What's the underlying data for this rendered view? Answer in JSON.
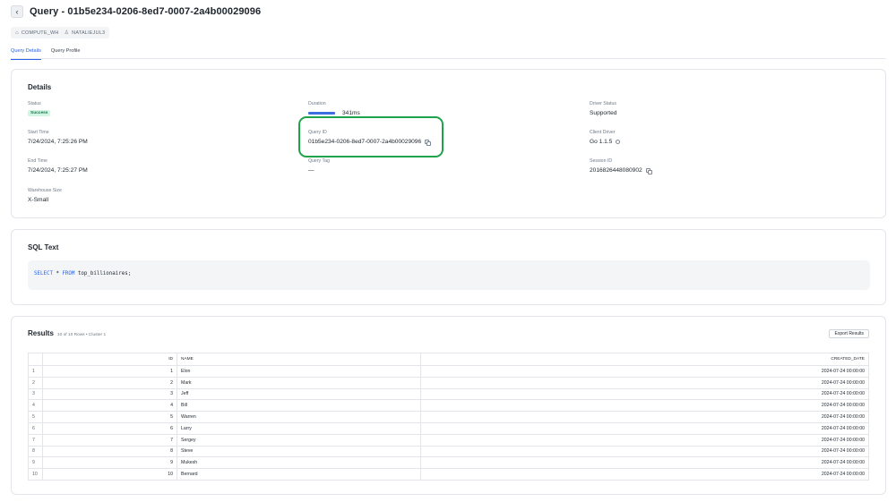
{
  "header": {
    "back_icon": "chevron-left-icon",
    "title": "Query - 01b5e234-0206-8ed7-0007-2a4b00029096"
  },
  "chips": [
    {
      "icon": "warehouse-icon",
      "label": "COMPUTE_WH"
    },
    {
      "icon": "user-icon",
      "label": "NATALIEJUL3"
    }
  ],
  "tabs": [
    {
      "label": "Query Details",
      "active": true
    },
    {
      "label": "Query Profile",
      "active": false
    }
  ],
  "details": {
    "title": "Details",
    "status": {
      "label": "Status",
      "value": "Success"
    },
    "duration": {
      "label": "Duration",
      "value": "341ms",
      "bar_fraction": 1.0
    },
    "driver_status": {
      "label": "Driver Status",
      "value": "Supported"
    },
    "start_time": {
      "label": "Start Time",
      "value": "7/24/2024, 7:25:26 PM"
    },
    "query_id": {
      "label": "Query ID",
      "value": "01b5e234-0206-8ed7-0007-2a4b00029096"
    },
    "client_driver": {
      "label": "Client Driver",
      "value": "Go 1.1.5"
    },
    "end_time": {
      "label": "End Time",
      "value": "7/24/2024, 7:25:27 PM"
    },
    "query_tag": {
      "label": "Query Tag",
      "value": "—"
    },
    "session_id": {
      "label": "Session ID",
      "value": "2016826448080902"
    },
    "warehouse_size": {
      "label": "Warehouse Size",
      "value": "X-Small"
    }
  },
  "sql": {
    "title": "SQL Text",
    "kw1": "SELECT",
    "star": " * ",
    "kw2": "FROM",
    "rest": " top_billionaires;"
  },
  "results": {
    "title": "Results",
    "subtitle": "10 of 10 Rows • Cluster 1",
    "export_label": "Export Results",
    "columns": [
      "",
      "ID",
      "NAME",
      "CREATED_DATE"
    ],
    "rows": [
      {
        "n": "1",
        "id": "1",
        "name": "Elon",
        "date": "2024-07-24 00:00:00"
      },
      {
        "n": "2",
        "id": "2",
        "name": "Mark",
        "date": "2024-07-24 00:00:00"
      },
      {
        "n": "3",
        "id": "3",
        "name": "Jeff",
        "date": "2024-07-24 00:00:00"
      },
      {
        "n": "4",
        "id": "4",
        "name": "Bill",
        "date": "2024-07-24 00:00:00"
      },
      {
        "n": "5",
        "id": "5",
        "name": "Warren",
        "date": "2024-07-24 00:00:00"
      },
      {
        "n": "6",
        "id": "6",
        "name": "Larry",
        "date": "2024-07-24 00:00:00"
      },
      {
        "n": "7",
        "id": "7",
        "name": "Sergey",
        "date": "2024-07-24 00:00:00"
      },
      {
        "n": "8",
        "id": "8",
        "name": "Steve",
        "date": "2024-07-24 00:00:00"
      },
      {
        "n": "9",
        "id": "9",
        "name": "Mukesh",
        "date": "2024-07-24 00:00:00"
      },
      {
        "n": "10",
        "id": "10",
        "name": "Bernard",
        "date": "2024-07-24 00:00:00"
      }
    ]
  },
  "colors": {
    "accent": "#2563eb",
    "success_bg": "#d3f5e4",
    "success_text": "#1a7a4a",
    "highlight": "#1fa34a"
  }
}
